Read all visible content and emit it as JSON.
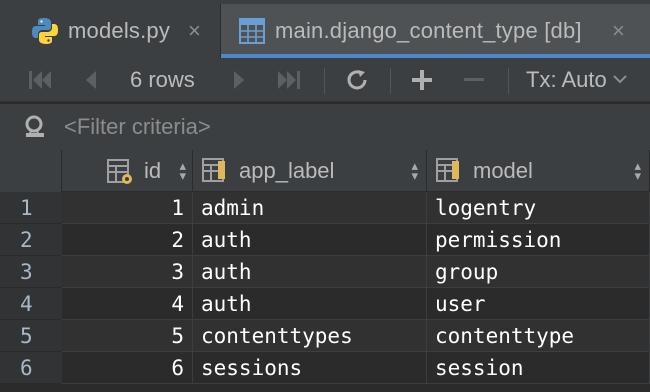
{
  "tabs": [
    {
      "label": "models.py",
      "icon": "python-file-icon",
      "active": false
    },
    {
      "label": "main.django_content_type [db]",
      "icon": "table-icon",
      "active": true
    }
  ],
  "toolbar": {
    "rows_label": "6 rows",
    "tx_label": "Tx: Auto"
  },
  "filter": {
    "placeholder": "<Filter criteria>"
  },
  "table": {
    "columns": [
      "id",
      "app_label",
      "model"
    ],
    "rows": [
      {
        "num": "1",
        "id": "1",
        "app_label": "admin",
        "model": "logentry"
      },
      {
        "num": "2",
        "id": "2",
        "app_label": "auth",
        "model": "permission"
      },
      {
        "num": "3",
        "id": "3",
        "app_label": "auth",
        "model": "group"
      },
      {
        "num": "4",
        "id": "4",
        "app_label": "auth",
        "model": "user"
      },
      {
        "num": "5",
        "id": "5",
        "app_label": "contenttypes",
        "model": "contenttype"
      },
      {
        "num": "6",
        "id": "6",
        "app_label": "sessions",
        "model": "session"
      }
    ]
  },
  "colors": {
    "accent": "#4a88c7",
    "background": "#2b2b2b",
    "panel": "#3c3f41"
  }
}
